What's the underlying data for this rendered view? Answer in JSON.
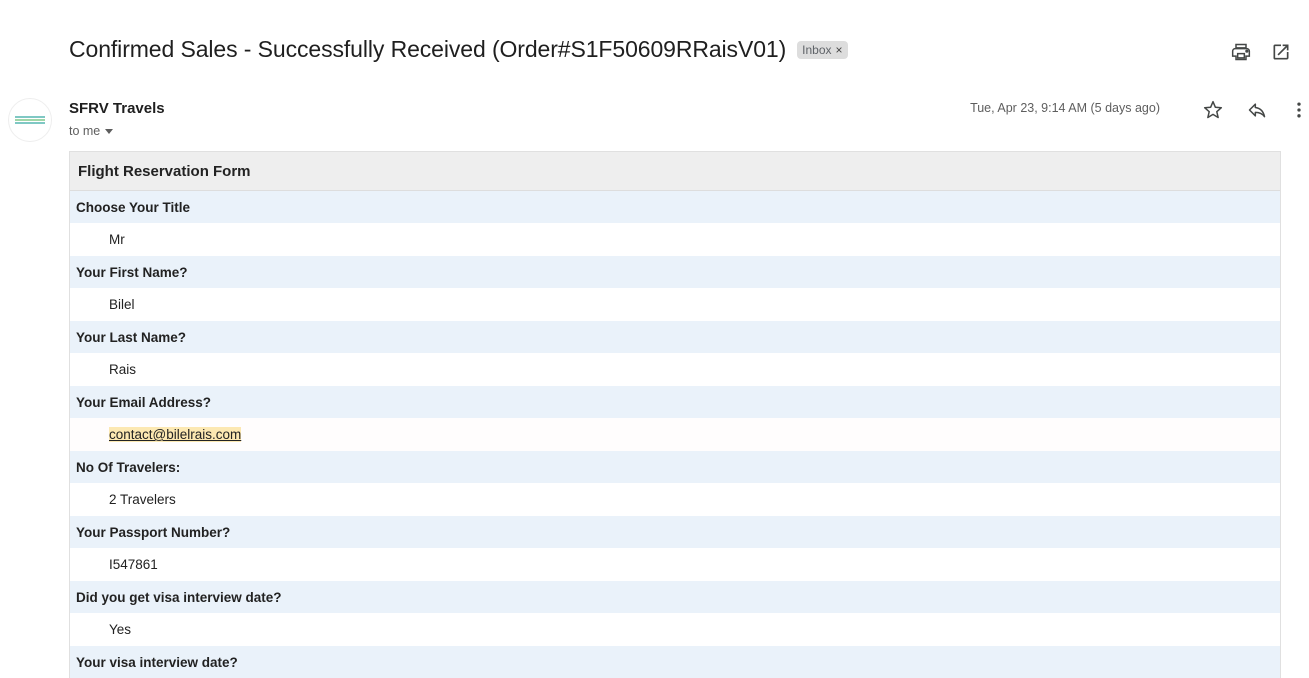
{
  "subject": "Confirmed Sales - Successfully Received (Order#S1F50609RRaisV01)",
  "label": {
    "text": "Inbox",
    "remove_glyph": "×"
  },
  "toolbar": {
    "icons": [
      "print-icon",
      "open-in-new-window-icon"
    ]
  },
  "sender": {
    "name": "SFRV Travels",
    "recipient": "to me"
  },
  "date": "Tue, Apr 23, 9:14 AM (5 days ago)",
  "message_actions": {
    "icons": [
      "star-icon",
      "reply-icon",
      "more-vert-icon"
    ]
  },
  "form": {
    "title": "Flight Reservation Form",
    "fields": [
      {
        "question": "Choose Your Title",
        "answer": "Mr"
      },
      {
        "question": "Your First Name?",
        "answer": "Bilel"
      },
      {
        "question": "Your Last Name?",
        "answer": "Rais"
      },
      {
        "question": "Your Email Address?",
        "answer": "contact@bilelrais.com"
      },
      {
        "question": "No Of Travelers:",
        "answer": "2 Travelers"
      },
      {
        "question": "Your Passport Number?",
        "answer": "I547861"
      },
      {
        "question": "Did you get visa interview date?",
        "answer": "Yes"
      },
      {
        "question": "Your visa interview date?",
        "answer": ""
      }
    ]
  }
}
